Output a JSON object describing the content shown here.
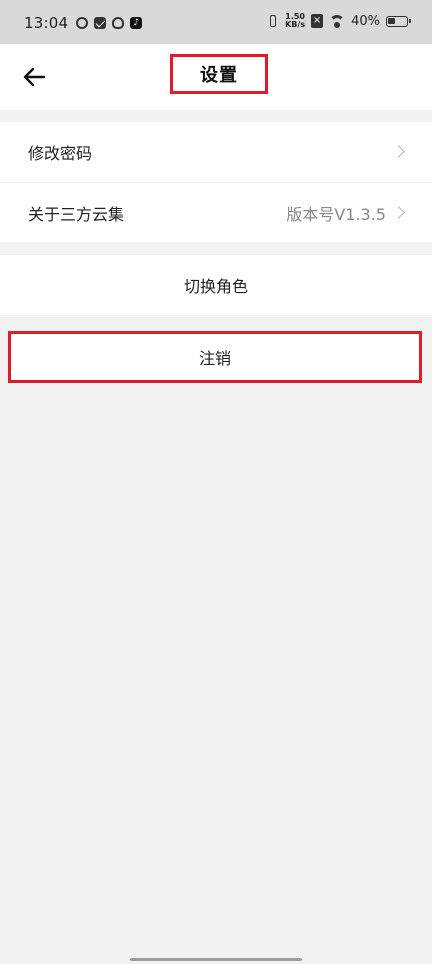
{
  "status_bar": {
    "time": "13:04",
    "network_speed_value": "1.50",
    "network_speed_unit": "KB/s",
    "battery_percent": "40%",
    "battery_level": 0.4,
    "left_icons": [
      "loop-icon",
      "mail-icon",
      "cat-icon",
      "tiktok-icon"
    ],
    "right_icons": [
      "vibrate-icon",
      "close-box-icon",
      "wifi-icon",
      "battery-icon"
    ]
  },
  "header": {
    "title": "设置",
    "back_icon": "arrow-left-icon"
  },
  "settings": {
    "items": [
      {
        "label": "修改密码",
        "value": ""
      },
      {
        "label": "关于三方云集",
        "value": "版本号V1.3.5"
      }
    ]
  },
  "actions": {
    "switch_role": "切换角色",
    "logout": "注销"
  },
  "colors": {
    "highlight_border": "#e01b2a",
    "background": "#f2f2f2",
    "card": "#ffffff",
    "status_bar": "#d9d9d9"
  }
}
